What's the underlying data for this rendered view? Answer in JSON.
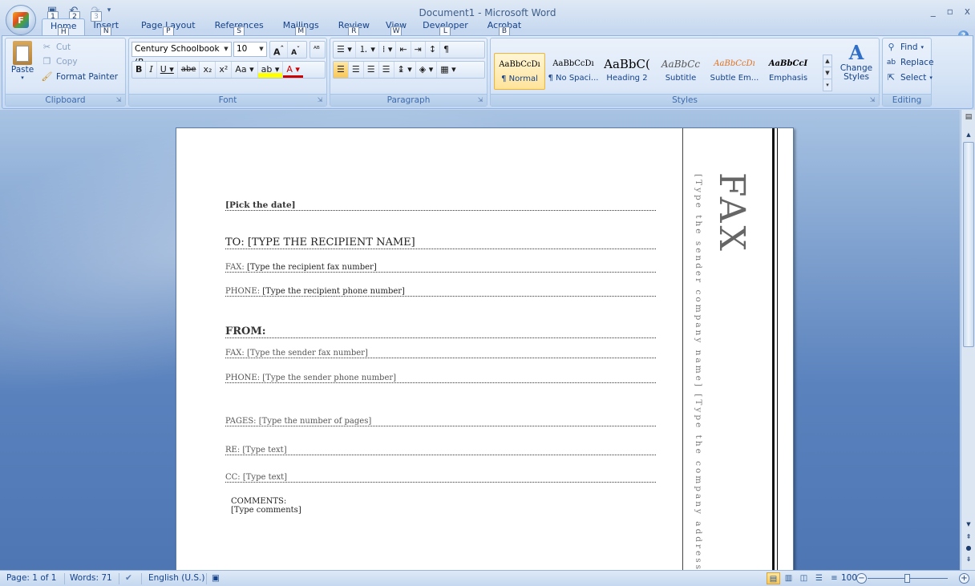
{
  "window": {
    "title": "Document1 - Microsoft Word",
    "office_key": "F",
    "controls": [
      "_",
      "▫",
      "x"
    ]
  },
  "qat": {
    "keytips": [
      "1",
      "2",
      "3"
    ]
  },
  "tabs": [
    {
      "label": "Home",
      "key": "H"
    },
    {
      "label": "Insert",
      "key": "N"
    },
    {
      "label": "Page Layout",
      "key": "P"
    },
    {
      "label": "References",
      "key": "S"
    },
    {
      "label": "Mailings",
      "key": "M"
    },
    {
      "label": "Review",
      "key": "R"
    },
    {
      "label": "View",
      "key": "W"
    },
    {
      "label": "Developer",
      "key": "L"
    },
    {
      "label": "Acrobat",
      "key": "B"
    }
  ],
  "ribbon": {
    "clipboard": {
      "label": "Clipboard",
      "paste": "Paste",
      "cut": "Cut",
      "copy": "Copy",
      "format_painter": "Format Painter"
    },
    "font": {
      "label": "Font",
      "font_name": "Century Schoolbook (B",
      "font_size": "10"
    },
    "paragraph": {
      "label": "Paragraph"
    },
    "styles": {
      "label": "Styles",
      "items": [
        {
          "sample": "AaBbCcDı",
          "name": "¶ Normal"
        },
        {
          "sample": "AaBbCcDı",
          "name": "¶ No Spaci..."
        },
        {
          "sample": "AaBbC(",
          "name": "Heading 2"
        },
        {
          "sample": "AaBbCc",
          "name": "Subtitle"
        },
        {
          "sample": "AaBbCcDı",
          "name": "Subtle Em..."
        },
        {
          "sample": "AaBbCcI",
          "name": "Emphasis"
        }
      ],
      "change_styles": "Change Styles"
    },
    "editing": {
      "label": "Editing",
      "find": "Find",
      "replace": "Replace",
      "select": "Select"
    }
  },
  "document": {
    "date": "[Pick the date]",
    "to": "TO: [TYPE THE RECIPIENT NAME]",
    "fax_label": "FAX:",
    "fax_value": "[Type the recipient fax number]",
    "phone_label": "PHONE:",
    "phone_value": "[Type the recipient phone number]",
    "from": "FROM:",
    "sender_fax": "FAX: [Type the sender fax number]",
    "sender_phone": "PHONE: [Type the sender phone number]",
    "pages": "PAGES: [Type the number of pages]",
    "re": "RE: [Type text]",
    "cc": "CC: [Type text]",
    "comments_label": "COMMENTS:",
    "comments_value": "[Type comments]",
    "fax_title": "FAX",
    "side_text": "[Type the sender company name] [Type the company address] [Type th"
  },
  "status": {
    "page": "Page: 1 of 1",
    "words": "Words: 71",
    "language": "English (U.S.)",
    "zoom": "100%"
  }
}
